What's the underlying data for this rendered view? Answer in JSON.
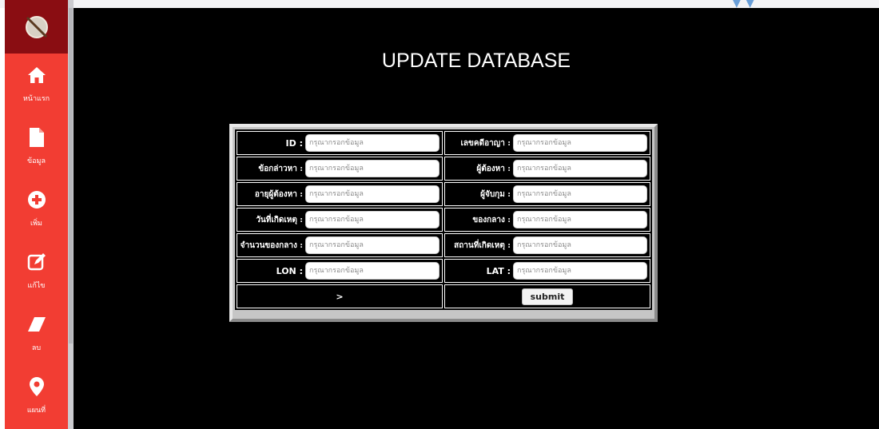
{
  "colors": {
    "sidebar": "#f23d33",
    "sidebar_logo_bg": "#8a0d12",
    "main_bg": "#000000",
    "title_text": "#ffffff"
  },
  "sidebar": {
    "logo_icon": "logo-icon",
    "items": [
      {
        "label": "หน้าแรก",
        "icon": "home-icon"
      },
      {
        "label": "ข้อมูล",
        "icon": "document-icon"
      },
      {
        "label": "เพิ่ม",
        "icon": "plus-circle-icon"
      },
      {
        "label": "แก้ไข",
        "icon": "edit-icon"
      },
      {
        "label": "ลบ",
        "icon": "eraser-icon"
      },
      {
        "label": "แผนที่",
        "icon": "map-marker-icon"
      }
    ]
  },
  "page": {
    "title": "UPDATE DATABASE"
  },
  "form": {
    "placeholder": "กรุณากรอกข้อมูล",
    "fields": {
      "id": {
        "label": "ID :"
      },
      "case_number": {
        "label": "เลขคดีอาญา :"
      },
      "charge": {
        "label": "ข้อกล่าวหา :"
      },
      "suspect": {
        "label": "ผู้ต้องหา :"
      },
      "suspect_age": {
        "label": "อายุผู้ต้องหา :"
      },
      "arrester": {
        "label": "ผู้จับกุม :"
      },
      "incident_date": {
        "label": "วันที่เกิดเหตุ :"
      },
      "evidence": {
        "label": "ของกลาง :"
      },
      "evidence_count": {
        "label": "จำนวนของกลาง :"
      },
      "incident_place": {
        "label": "สถานที่เกิดเหตุ :"
      },
      "lon": {
        "label": "LON :"
      },
      "lat": {
        "label": "LAT :"
      }
    },
    "arrow_text": ">",
    "submit_label": "submit"
  }
}
